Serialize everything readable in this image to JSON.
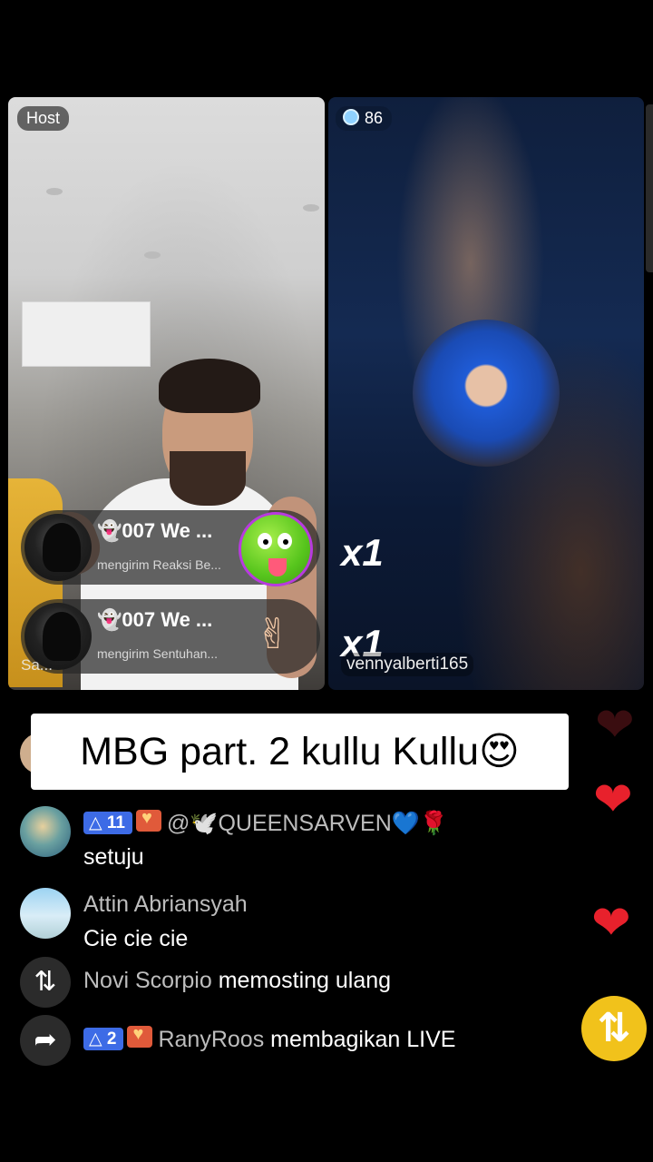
{
  "host_panel": {
    "badge": "Host",
    "name_label": "Sa...",
    "notifications": [
      {
        "name": "👻007 We ...",
        "subtitle": "mengirim Reaksi Be..."
      },
      {
        "name": "👻007 We ...",
        "subtitle": "mengirim Sentuhan..."
      }
    ]
  },
  "guest_panel": {
    "score": "86",
    "multipliers": [
      "x1",
      "x1"
    ],
    "name_label": "vennyalberti165"
  },
  "caption": "MBG part. 2 kullu Kullu😍",
  "comments": [
    {
      "level": "11",
      "user": "@🕊️QUEENSARVEN💙🌹",
      "text": "setuju"
    },
    {
      "user": "Attin Abriansyah",
      "text": "Cie cie cie"
    }
  ],
  "activities": [
    {
      "icon": "repost-icon",
      "user": "Novi Scorpio",
      "action": "memosting ulang"
    },
    {
      "icon": "share-icon",
      "level": "2",
      "user": "RanyRoos",
      "action": "membagikan LIVE"
    }
  ],
  "colors": {
    "level_badge": "#3d6be6",
    "heart": "#e8212c",
    "repost_button": "#f1c21b"
  }
}
